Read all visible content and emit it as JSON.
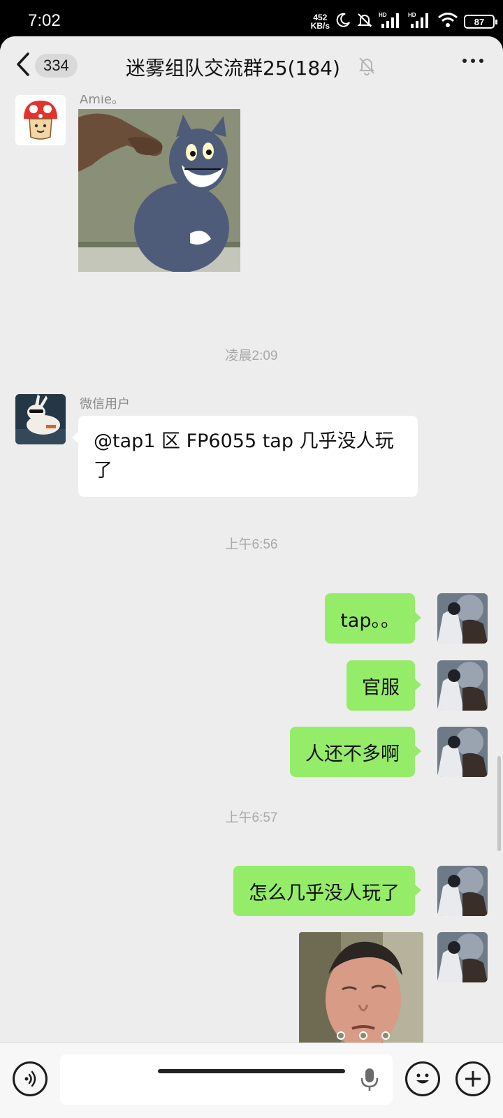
{
  "status_bar": {
    "time": "7:02",
    "net_speed_value": "452",
    "net_speed_unit": "KB/s",
    "signal_tag_1": "HD",
    "signal_tag_2": "HD",
    "battery": "87"
  },
  "header": {
    "unread_count": "334",
    "title": "迷雾组队交流群25(184)",
    "icons": [
      "back-arrow",
      "mute-bell",
      "more-dots"
    ]
  },
  "messages": [
    {
      "type": "image",
      "side": "left",
      "sender": "Amie。",
      "image_desc_icon": "sticker-cat-pointing"
    },
    {
      "type": "time",
      "text": "凌晨2:09"
    },
    {
      "type": "text",
      "side": "left",
      "sender": "微信用户",
      "text_line1": "@tap1 区 FP6055 tap 几乎没人玩",
      "text_line2": "了"
    },
    {
      "type": "time",
      "text": "上午6:56"
    },
    {
      "type": "text",
      "side": "right",
      "text": "tap。。"
    },
    {
      "type": "text",
      "side": "right",
      "text": "官服"
    },
    {
      "type": "text",
      "side": "right",
      "text": "人还不多啊"
    },
    {
      "type": "time",
      "text": "上午6:57"
    },
    {
      "type": "text",
      "side": "right",
      "text": "怎么几乎没人玩了"
    },
    {
      "type": "image",
      "side": "right",
      "image_desc_icon": "sticker-man-face"
    }
  ],
  "input_bar": {
    "placeholder": "",
    "icons": [
      "voice-mode",
      "microphone",
      "emoji",
      "plus"
    ]
  },
  "colors": {
    "background": "#ededed",
    "self_bubble": "#95ec69",
    "other_bubble": "#ffffff"
  }
}
